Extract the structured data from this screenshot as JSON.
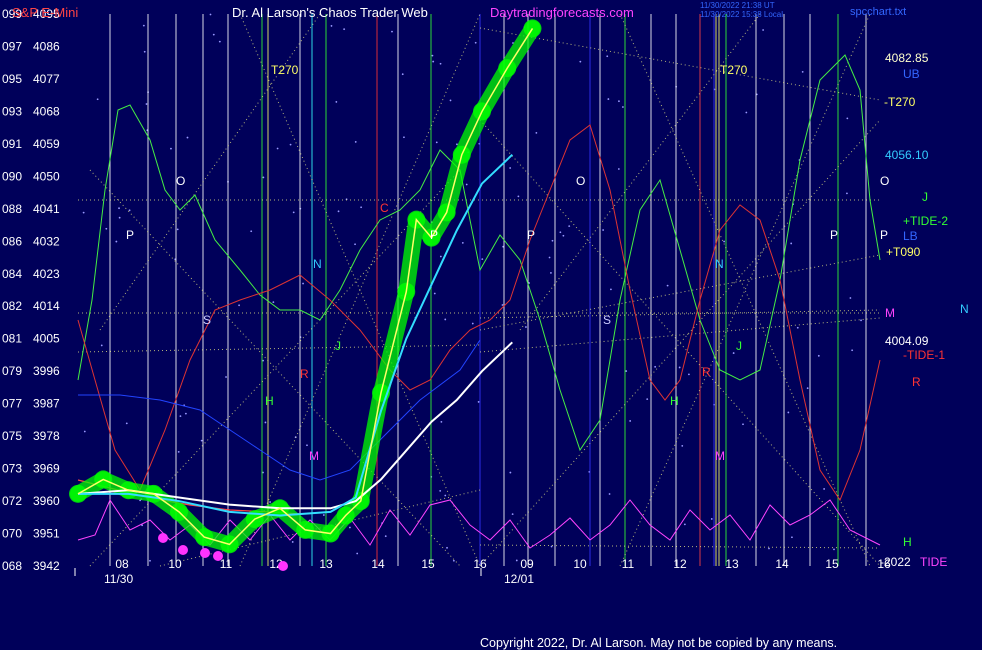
{
  "header": {
    "instrument": "S&P E-Mini",
    "site": "Dr. Al Larson's Chaos Trader Web",
    "link": "Daytradingforecasts.com",
    "timestamp_1": "11/30/2022 21:38 UT",
    "timestamp_2": "11/30/2022 15:38 Local",
    "file": "spcchart.txt"
  },
  "copyright": "Copyright 2022, Dr. Al Larson. May not be copied by any means.",
  "colors": {
    "background": "#00005a",
    "price": "#ffff66",
    "glow": "#00ff00",
    "fast_ma": "#33ddff",
    "slow_ma": "#ffffff",
    "tide": "#ff44ff"
  },
  "chart_data": {
    "type": "line",
    "ylim": [
      3942,
      4095
    ],
    "y_ticks": [
      {
        "code": "099",
        "price": 4095
      },
      {
        "code": "097",
        "price": 4086
      },
      {
        "code": "095",
        "price": 4077
      },
      {
        "code": "093",
        "price": 4068
      },
      {
        "code": "091",
        "price": 4059
      },
      {
        "code": "090",
        "price": 4050
      },
      {
        "code": "088",
        "price": 4041
      },
      {
        "code": "086",
        "price": 4032
      },
      {
        "code": "084",
        "price": 4023
      },
      {
        "code": "082",
        "price": 4014
      },
      {
        "code": "081",
        "price": 4005
      },
      {
        "code": "079",
        "price": 3996
      },
      {
        "code": "077",
        "price": 3987
      },
      {
        "code": "075",
        "price": 3978
      },
      {
        "code": "073",
        "price": 3969
      },
      {
        "code": "072",
        "price": 3960
      },
      {
        "code": "070",
        "price": 3951
      },
      {
        "code": "068",
        "price": 3942
      }
    ],
    "x_ticks": [
      "08",
      "10",
      "11",
      "12",
      "13",
      "14",
      "15",
      "16",
      "09",
      "10",
      "11",
      "12",
      "13",
      "14",
      "15",
      "16"
    ],
    "date_labels": [
      "11/30",
      "12/01"
    ],
    "series": [
      {
        "role": "price",
        "x": [
          0,
          0.5,
          1,
          1.5,
          2,
          2.5,
          3,
          3.5,
          4,
          4.5,
          5,
          5.3,
          5.6,
          6,
          6.5,
          6.7,
          7,
          7.3,
          7.6,
          8,
          8.5,
          9
        ],
        "y": [
          3962,
          3966,
          3963,
          3962,
          3957,
          3950,
          3948,
          3955,
          3958,
          3952,
          3951,
          3956,
          3960,
          3990,
          4018,
          4038,
          4033,
          4040,
          4056,
          4068,
          4080,
          4091
        ]
      },
      {
        "role": "fast_ma",
        "x": [
          0,
          1,
          2,
          3,
          4,
          5,
          5.5,
          6,
          6.5,
          7,
          7.5,
          8,
          8.6
        ],
        "y": [
          3962,
          3962,
          3960,
          3957,
          3956,
          3957,
          3961,
          3985,
          4005,
          4020,
          4035,
          4048,
          4056
        ]
      },
      {
        "role": "slow_ma",
        "x": [
          0,
          1,
          2,
          3,
          4,
          5,
          5.5,
          6,
          6.5,
          7,
          7.5,
          8,
          8.6
        ],
        "y": [
          3962,
          3963,
          3961,
          3959,
          3958,
          3958,
          3960,
          3966,
          3974,
          3982,
          3988,
          3996,
          4004
        ]
      }
    ],
    "annotations": {
      "levels": [
        {
          "label": "4082.85",
          "price": 4082.85
        },
        {
          "label": "4056.10",
          "price": 4056.1
        },
        {
          "label": "4004.09",
          "price": 4004.09
        }
      ],
      "right_labels": [
        "UB",
        "-T270",
        "J",
        "+TIDE-2",
        "LB",
        "+T090",
        "M",
        "-TIDE-1",
        "R",
        "H",
        "-2022",
        "TIDE",
        "N"
      ],
      "markers": [
        "T270",
        "T270",
        "O",
        "O",
        "O",
        "P",
        "P",
        "P",
        "P",
        "P",
        "S",
        "S",
        "N",
        "N",
        "R",
        "R",
        "H",
        "H",
        "M",
        "M",
        "J",
        "J",
        "C"
      ]
    }
  }
}
